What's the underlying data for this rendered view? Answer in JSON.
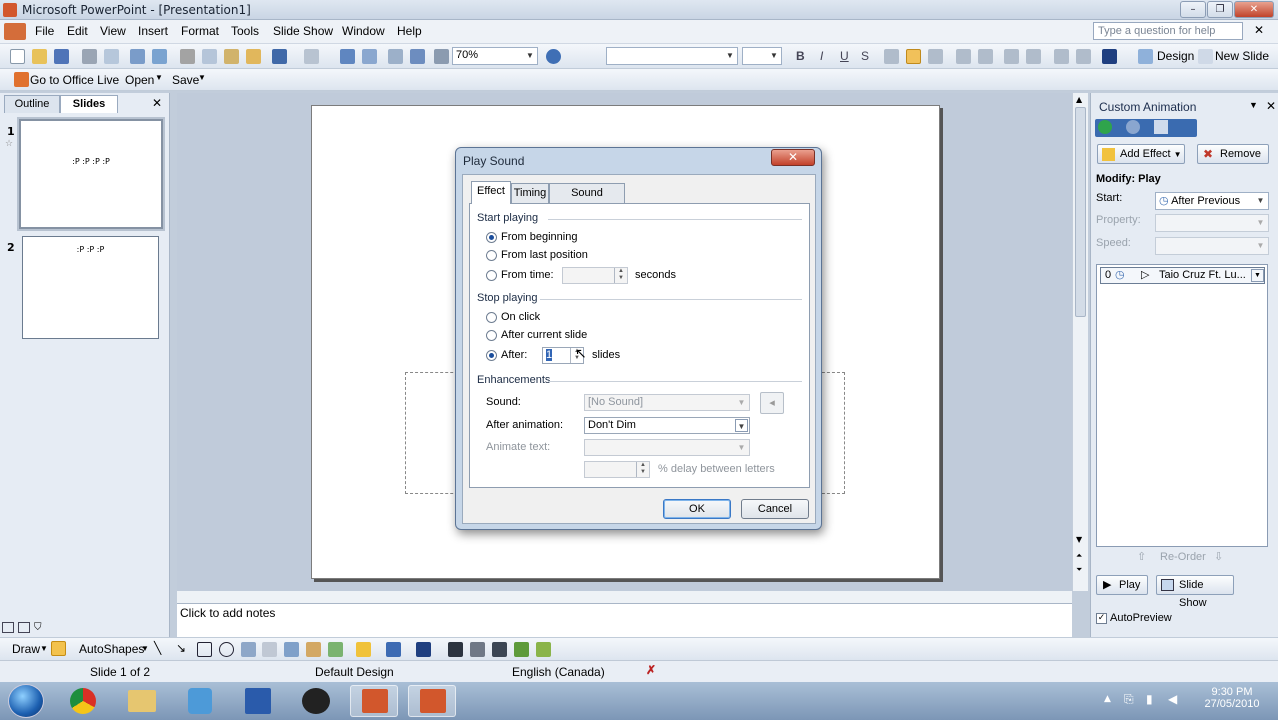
{
  "window": {
    "title": "Microsoft PowerPoint - [Presentation1]",
    "controls": {
      "minimize": "–",
      "restore": "❐",
      "close": "✕"
    }
  },
  "menu": {
    "items": [
      "File",
      "Edit",
      "View",
      "Insert",
      "Format",
      "Tools",
      "Slide Show",
      "Window",
      "Help"
    ],
    "help_placeholder": "Type a question for help"
  },
  "toolbar": {
    "zoom": "70%",
    "design_label": "Design",
    "new_slide_label": "New Slide",
    "office_live_label": "Go to Office Live",
    "open_label": "Open",
    "save_label": "Save",
    "bold": "B",
    "italic": "I",
    "underline": "U",
    "shadow": "S"
  },
  "left_pane": {
    "tabs": [
      "Outline",
      "Slides"
    ],
    "close": "✕",
    "slides": [
      {
        "number": "1",
        "text": ":P :P :P :P"
      },
      {
        "number": "2",
        "text": ":P :P :P"
      }
    ]
  },
  "notes": {
    "placeholder": "Click to add notes"
  },
  "task_pane": {
    "title": "Custom Animation",
    "add_effect": "Add Effect",
    "remove": "Remove",
    "modify": "Modify: Play",
    "start_label": "Start:",
    "start_value": "After Previous",
    "property_label": "Property:",
    "speed_label": "Speed:",
    "list_item_index": "0",
    "list_item_text": "Taio Cruz Ft. Lu...",
    "reorder": "Re-Order",
    "play": "Play",
    "slide_show": "Slide Show",
    "autopreview": "AutoPreview"
  },
  "drawbar": {
    "draw": "Draw",
    "autoshapes": "AutoShapes"
  },
  "status": {
    "slide": "Slide 1 of 2",
    "design": "Default Design",
    "language": "English (Canada)"
  },
  "taskbar": {
    "time": "9:30 PM",
    "date": "27/05/2010"
  },
  "dialog": {
    "title": "Play Sound",
    "tabs": [
      "Effect",
      "Timing",
      "Sound Settings"
    ],
    "start_group": "Start playing",
    "start_options": [
      "From beginning",
      "From last position",
      "From time:"
    ],
    "start_selected": 0,
    "seconds_label": "seconds",
    "stop_group": "Stop playing",
    "stop_options": [
      "On click",
      "After current slide",
      "After:"
    ],
    "stop_selected": 2,
    "after_value": "1",
    "slides_label": "slides",
    "enh_group": "Enhancements",
    "sound_label": "Sound:",
    "sound_value": "[No Sound]",
    "after_anim_label": "After animation:",
    "after_anim_value": "Don't Dim",
    "animate_text_label": "Animate text:",
    "delay_label": "% delay between letters",
    "ok": "OK",
    "cancel": "Cancel"
  }
}
